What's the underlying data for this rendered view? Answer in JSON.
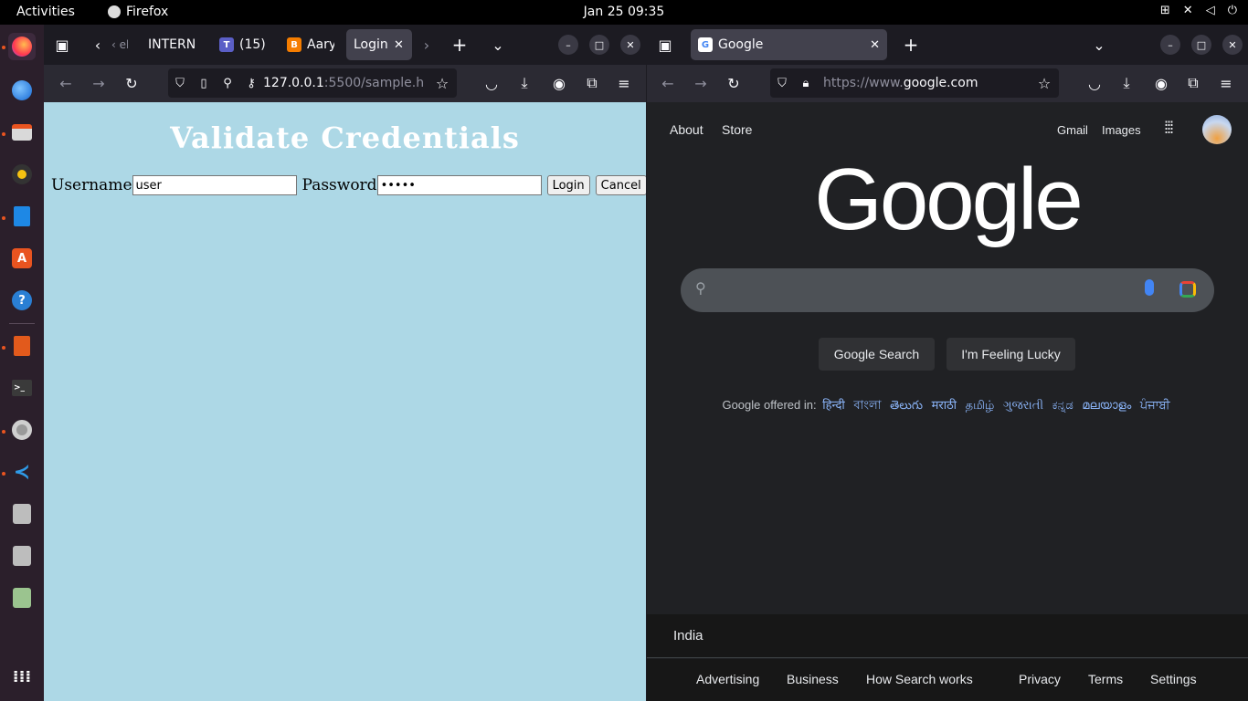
{
  "topbar": {
    "activities": "Activities",
    "app_name": "Firefox",
    "clock": "Jan 25  09:35"
  },
  "dock": {
    "items": [
      "firefox",
      "thunderbird",
      "files",
      "rhythmbox",
      "writer",
      "app-center",
      "help",
      "impress",
      "terminal",
      "settings",
      "vscode",
      "disc",
      "disc",
      "trash",
      "show-apps"
    ]
  },
  "left_window": {
    "tabs": [
      {
        "label": "‹ eb",
        "icon": "back-chevron"
      },
      {
        "label": "INTERN",
        "icon": "none"
      },
      {
        "label": "(15)",
        "icon": "teams-icon"
      },
      {
        "label": "Aary",
        "icon": "blogger-icon"
      },
      {
        "label": "Login",
        "icon": "none",
        "active": true
      }
    ],
    "url": "127.0.0.1:5500/sample.h",
    "url_host": "127.0.0.1",
    "url_rest": ":5500/sample.h",
    "page": {
      "title": "Validate Credentials",
      "username_label": "Username",
      "username_value": "user",
      "password_label": "Password",
      "password_value": "•••••",
      "login_label": "Login",
      "cancel_label": "Cancel"
    },
    "background_color": "#add8e6"
  },
  "right_window": {
    "tab_title": "Google",
    "url_prefix": "https://www.",
    "url_domain": "google.com",
    "page": {
      "header_left": [
        "About",
        "Store"
      ],
      "header_right": [
        "Gmail",
        "Images"
      ],
      "logo": "Google",
      "search_button": "Google Search",
      "lucky_button": "I'm Feeling Lucky",
      "offered_in": "Google offered in:",
      "languages": [
        "हिन्दी",
        "বাংলা",
        "తెలుగు",
        "मराठी",
        "தமிழ்",
        "ગુજરાતી",
        "ಕನ್ನಡ",
        "മലയാളം",
        "ਪੰਜਾਬੀ"
      ],
      "country": "India",
      "footer_links": [
        "Advertising",
        "Business",
        "How Search works",
        "Privacy",
        "Terms",
        "Settings"
      ]
    }
  },
  "colors": {
    "firefox_dark": "#1c1b22",
    "navbar": "#2b2a33",
    "google_bg": "#202124",
    "link_blue": "#8ab4f8"
  }
}
